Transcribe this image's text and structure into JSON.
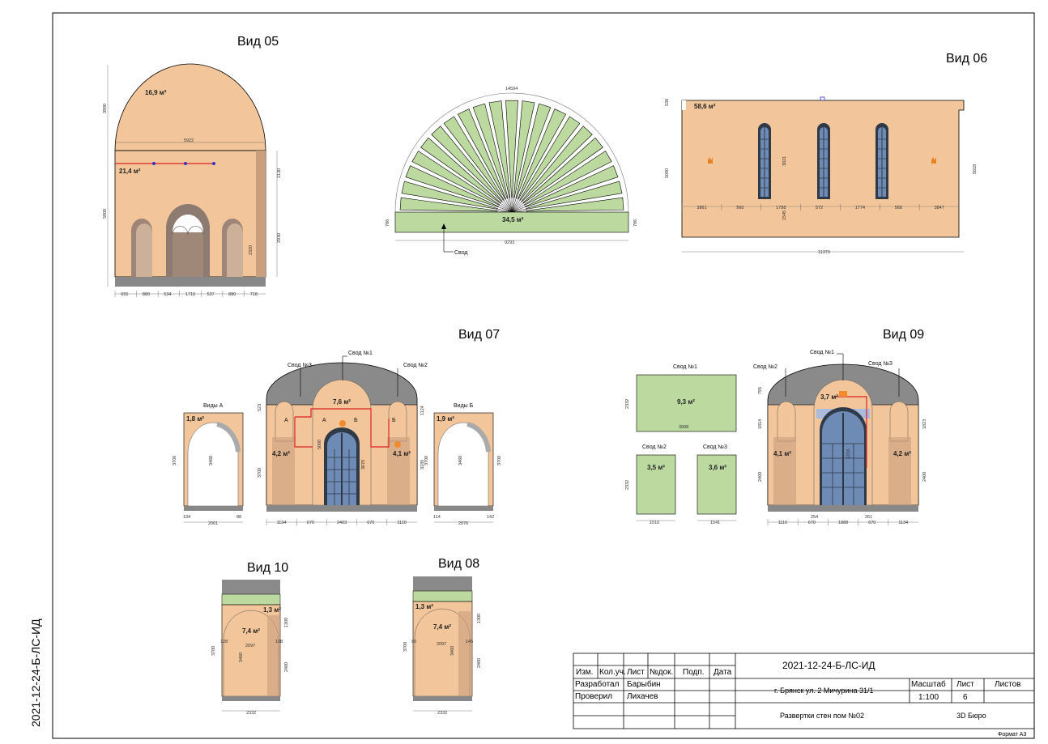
{
  "doc_code": "2021-12-24-Б-ЛС-ИД",
  "views": {
    "v05": {
      "title": "Вид 05",
      "area_top": "16,9 м²",
      "area_wall": "21,4 м²",
      "dims": {
        "h_top": "3900",
        "h_total": "5800",
        "r1": "2130",
        "r2": "2930",
        "r3": "2320",
        "width": "5922",
        "bottom": [
          "655",
          "880",
          "534",
          "1710",
          "537",
          "880",
          "718"
        ]
      }
    },
    "vault": {
      "area": "34,5 м²",
      "label": "Свод",
      "dims": {
        "top": "14594",
        "bottom": "9293",
        "left": "786",
        "right": "786"
      }
    },
    "v06": {
      "title": "Вид 06",
      "area": "58,6 м²",
      "dims": {
        "left_h": "5090",
        "right_h": "5618",
        "top_small": "538",
        "window_h": "3021",
        "sill_h": "1545",
        "total": "11379",
        "row": [
          "3861",
          "560",
          "1798",
          "572",
          "1774",
          "568",
          "3847"
        ]
      }
    },
    "v07": {
      "title": "Вид 07",
      "vault1": "Свод №1",
      "vault2": "Свод №2",
      "vault3": "Свод №3",
      "area_top": "7,6 м²",
      "area_left": "4,2 м²",
      "area_right": "4,1 м²",
      "mark_a": "А",
      "mark_b": "Б",
      "dims": {
        "h_left": "3700",
        "h_right": "3180",
        "arch": "523",
        "r": "1124",
        "door": "3070",
        "w1": "5000",
        "bottom": [
          "1134",
          "670",
          "2403",
          "670",
          "1110"
        ]
      }
    },
    "va": {
      "title": "Виды А",
      "area": "1,8 м²",
      "dims": {
        "h": "3700",
        "inner": "3460",
        "w": "2061",
        "l": "134",
        "r": "88"
      }
    },
    "vb": {
      "title": "Виды Б",
      "area": "1,9 м²",
      "dims": {
        "h": "3700",
        "inner": "3460",
        "w": "2076",
        "l": "114",
        "r": "142"
      }
    },
    "vaults": {
      "s1": {
        "label": "Свод №1",
        "area": "9,3 м²",
        "h": "2332",
        "w": "3908"
      },
      "s2": {
        "label": "Свод №2",
        "area": "3,5 м²",
        "h": "2332",
        "w": "1510"
      },
      "s3": {
        "label": "Свод №3",
        "area": "3,6 м²",
        "w": "1541"
      }
    },
    "v09": {
      "title": "Вид 09",
      "vault1": "Свод №1",
      "vault2": "Свод №2",
      "vault3": "Свод №3",
      "area_top": "3,7 м²",
      "area_left": "4,1 м²",
      "area_right": "4,2 м²",
      "dims": {
        "h1": "795",
        "h2": "1814",
        "h3": "2400",
        "r1": "1823",
        "r2": "2400",
        "door": "1218",
        "bl": "254",
        "br": "261",
        "bottom": [
          "1110",
          "670",
          "1888",
          "670",
          "1134"
        ]
      }
    },
    "v10": {
      "title": "Вид 10",
      "area_top": "1,3 м²",
      "area_main": "7,4 м²",
      "dims": {
        "h": "3700",
        "r1": "1300",
        "r2": "2400",
        "inner": "3460",
        "w_in": "2097",
        "l": "128",
        "r": "108",
        "w": "2332"
      }
    },
    "v08": {
      "title": "Вид 08",
      "area_top": "1,3 м²",
      "area_main": "7,4 м²",
      "dims": {
        "h": "3700",
        "r1": "1300",
        "r2": "2400",
        "inner": "3460",
        "w_in": "2097",
        "l": "90",
        "r": "145",
        "w": "2332"
      }
    }
  },
  "stamp": {
    "code": "2021-12-24-Б-ЛС-ИД",
    "headers": [
      "Изм.",
      "Кол.уч.",
      "Лист",
      "№док.",
      "Подп.",
      "Дата"
    ],
    "role1": "Разработал",
    "name1": "Барыбин",
    "role2": "Проверил",
    "name2": "Лихачев",
    "address": "г. Брянск ул. 2 Мичурина 31/1",
    "scale_label": "Масштаб",
    "sheet_label": "Лист",
    "sheets_label": "Листов",
    "scale": "1:100",
    "sheet": "6",
    "title": "Развертки стен пом №02",
    "company": "3D Бюро",
    "format": "Формат А3"
  },
  "colors": {
    "wall": "#f2c69a",
    "shade": "#b58d74",
    "vault": "#bcd9a0",
    "dark": "#8a8a8a",
    "line": "#000000"
  }
}
